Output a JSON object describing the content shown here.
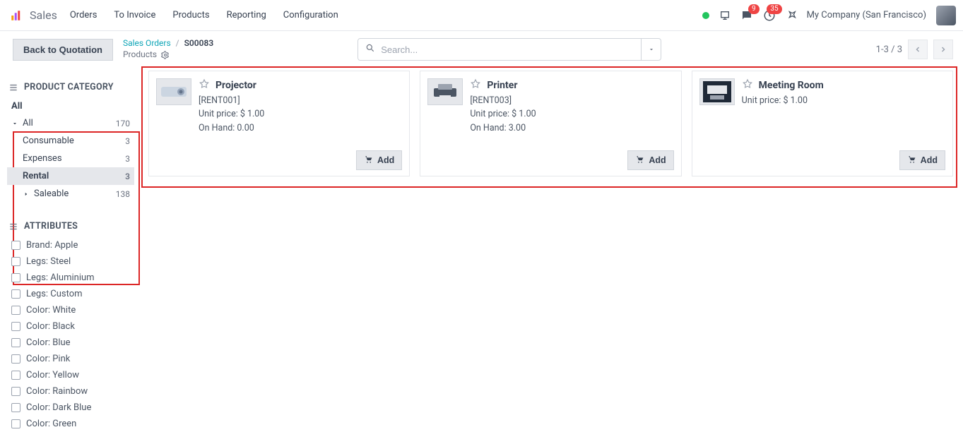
{
  "nav": {
    "app": "Sales",
    "items": [
      "Orders",
      "To Invoice",
      "Products",
      "Reporting",
      "Configuration"
    ],
    "badges": {
      "messages": "9",
      "activities": "35"
    },
    "company": "My Company (San Francisco)"
  },
  "controlbar": {
    "back_label": "Back to Quotation",
    "breadcrumb": {
      "root": "Sales Orders",
      "order": "S00083",
      "page": "Products"
    },
    "search": {
      "placeholder": "Search..."
    },
    "pager": {
      "text": "1-3 / 3"
    }
  },
  "sidebar": {
    "category_header": "PRODUCT CATEGORY",
    "all_label": "All",
    "root_label": "All",
    "root_count": "170",
    "items": [
      {
        "label": "Consumable",
        "count": "3"
      },
      {
        "label": "Expenses",
        "count": "3"
      },
      {
        "label": "Rental",
        "count": "3"
      },
      {
        "label": "Saleable",
        "count": "138"
      }
    ],
    "attributes_header": "ATTRIBUTES",
    "attributes": [
      "Brand: Apple",
      "Legs: Steel",
      "Legs: Aluminium",
      "Legs: Custom",
      "Color: White",
      "Color: Black",
      "Color: Blue",
      "Color: Pink",
      "Color: Yellow",
      "Color: Rainbow",
      "Color: Dark Blue",
      "Color: Green"
    ]
  },
  "products": [
    {
      "title": "Projector",
      "ref": "[RENT001]",
      "price": "Unit price: $ 1.00",
      "onhand": "On Hand: 0.00",
      "add": "Add"
    },
    {
      "title": "Printer",
      "ref": "[RENT003]",
      "price": "Unit price: $ 1.00",
      "onhand": "On Hand: 3.00",
      "add": "Add"
    },
    {
      "title": "Meeting Room",
      "ref": "",
      "price": "Unit price: $ 1.00",
      "onhand": "",
      "add": "Add"
    }
  ]
}
